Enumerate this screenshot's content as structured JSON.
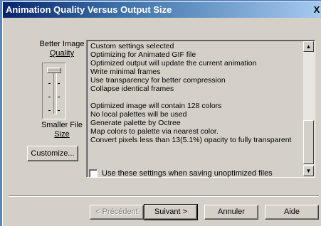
{
  "window": {
    "title": "Animation Quality Versus Output Size",
    "close_symbol": "X"
  },
  "quality": {
    "top_label_line1": "Better Image",
    "top_label_line2": "Quality",
    "bottom_label_line1": "Smaller File",
    "bottom_label_line2": "Size",
    "customize_label": "Customize..."
  },
  "info": {
    "lines": [
      "Custom settings selected",
      "Optimizing for Animated GIF file",
      "Optimized output will update the current animation",
      "Write minimal frames",
      "Use transparency for better compression",
      "Collapse identical frames",
      "",
      "Optimized image will contain 128 colors",
      "No local palettes will be used",
      "Generate palette by Octree",
      "Map colors to palette via nearest color.",
      "Convert pixels less than 13(5.1%) opacity to fully transparent"
    ]
  },
  "checkbox": {
    "label": "Use these settings when saving unoptimized files",
    "checked": false
  },
  "buttons": {
    "back": "< Précédent",
    "next": "Suivant >",
    "cancel": "Annuler",
    "help": "Aide"
  }
}
